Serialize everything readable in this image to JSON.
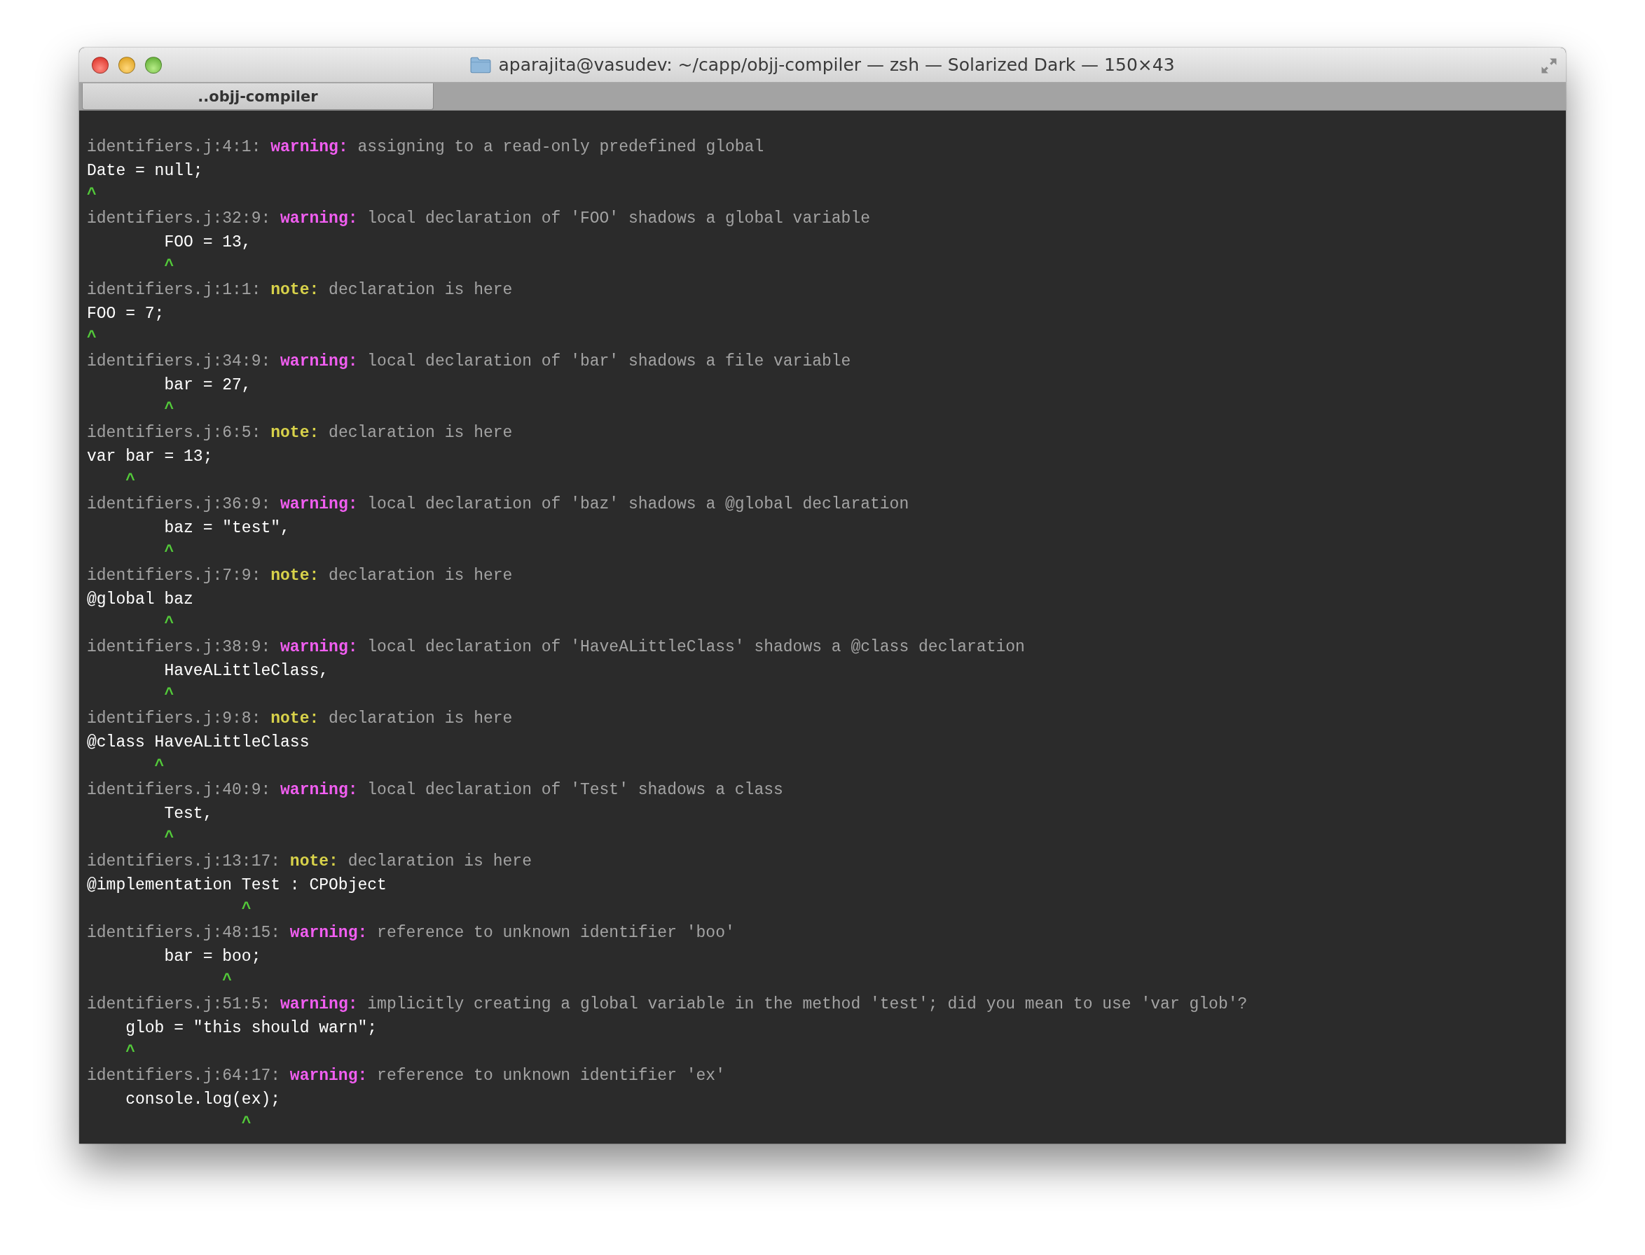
{
  "window": {
    "title": "aparajita@vasudev: ~/capp/objj-compiler — zsh — Solarized Dark — 150×43"
  },
  "tabs": [
    {
      "label": "..objj-compiler",
      "selected": true
    }
  ],
  "messages": [
    {
      "kind": "warning",
      "location": "identifiers.j:4:1:",
      "label": "warning:",
      "text": "assigning to a read-only predefined global",
      "code": "Date = null;",
      "caret": "^"
    },
    {
      "kind": "warning",
      "location": "identifiers.j:32:9:",
      "label": "warning:",
      "text": "local declaration of 'FOO' shadows a global variable",
      "code": "        FOO = 13,",
      "caret": "        ^"
    },
    {
      "kind": "note",
      "location": "identifiers.j:1:1:",
      "label": "note:",
      "text": "declaration is here",
      "code": "FOO = 7;",
      "caret": "^"
    },
    {
      "kind": "warning",
      "location": "identifiers.j:34:9:",
      "label": "warning:",
      "text": "local declaration of 'bar' shadows a file variable",
      "code": "        bar = 27,",
      "caret": "        ^"
    },
    {
      "kind": "note",
      "location": "identifiers.j:6:5:",
      "label": "note:",
      "text": "declaration is here",
      "code": "var bar = 13;",
      "caret": "    ^"
    },
    {
      "kind": "warning",
      "location": "identifiers.j:36:9:",
      "label": "warning:",
      "text": "local declaration of 'baz' shadows a @global declaration",
      "code": "        baz = \"test\",",
      "caret": "        ^"
    },
    {
      "kind": "note",
      "location": "identifiers.j:7:9:",
      "label": "note:",
      "text": "declaration is here",
      "code": "@global baz",
      "caret": "        ^"
    },
    {
      "kind": "warning",
      "location": "identifiers.j:38:9:",
      "label": "warning:",
      "text": "local declaration of 'HaveALittleClass' shadows a @class declaration",
      "code": "        HaveALittleClass,",
      "caret": "        ^"
    },
    {
      "kind": "note",
      "location": "identifiers.j:9:8:",
      "label": "note:",
      "text": "declaration is here",
      "code": "@class HaveALittleClass",
      "caret": "       ^"
    },
    {
      "kind": "warning",
      "location": "identifiers.j:40:9:",
      "label": "warning:",
      "text": "local declaration of 'Test' shadows a class",
      "code": "        Test,",
      "caret": "        ^"
    },
    {
      "kind": "note",
      "location": "identifiers.j:13:17:",
      "label": "note:",
      "text": "declaration is here",
      "code": "@implementation Test : CPObject",
      "caret": "                ^"
    },
    {
      "kind": "warning",
      "location": "identifiers.j:48:15:",
      "label": "warning:",
      "text": "reference to unknown identifier 'boo'",
      "code": "        bar = boo;",
      "caret": "              ^"
    },
    {
      "kind": "warning",
      "location": "identifiers.j:51:5:",
      "label": "warning:",
      "text": "implicitly creating a global variable in the method 'test'; did you mean to use 'var glob'?",
      "code": "    glob = \"this should warn\";",
      "caret": "    ^"
    },
    {
      "kind": "warning",
      "location": "identifiers.j:64:17:",
      "label": "warning:",
      "text": "reference to unknown identifier 'ex'",
      "code": "    console.log(ex);",
      "caret": "                ^"
    }
  ]
}
